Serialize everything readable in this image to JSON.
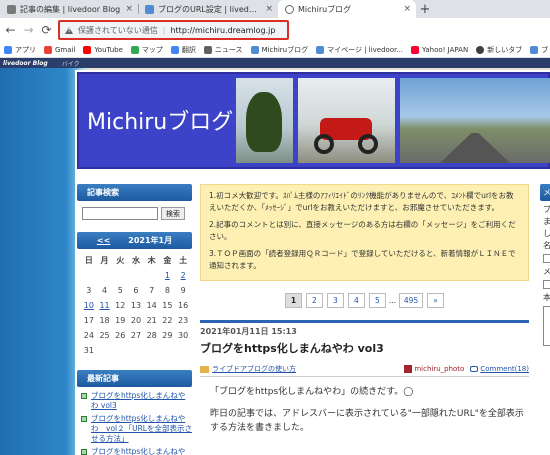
{
  "tabs": [
    {
      "label": "記事の編集 | livedoor Blog",
      "icon": "document-icon"
    },
    {
      "label": "ブログのURL設定 | livedoor Blog",
      "icon": "blog-icon"
    },
    {
      "label": "Michiruブログ",
      "icon": "globe-icon",
      "active": true
    }
  ],
  "new_tab": "+",
  "close_glyph": "×",
  "address": {
    "warning": "保護されていない通信",
    "separator": "|",
    "url": "http://michiru.dreamlog.jp"
  },
  "bookmarks": [
    {
      "label": "アプリ",
      "color": "#4285f4"
    },
    {
      "label": "Gmail",
      "color": "#ea4335"
    },
    {
      "label": "YouTube",
      "color": "#ff0000"
    },
    {
      "label": "マップ",
      "color": "#34a853"
    },
    {
      "label": "翻訳",
      "color": "#4285f4"
    },
    {
      "label": "ニュース",
      "color": "#5f6368"
    },
    {
      "label": "Michiruブログ",
      "color": "#4f8bd6"
    },
    {
      "label": "マイページ | livedoor...",
      "color": "#4f8bd6"
    },
    {
      "label": "Yahoo! JAPAN",
      "color": "#ff0033"
    },
    {
      "label": "新しいタブ",
      "color": "#3c4043"
    },
    {
      "label": "ブ",
      "color": "#4f8bd6"
    }
  ],
  "livedoor_bar": {
    "logo": "livedoor Blog",
    "link": "バイク"
  },
  "blog": {
    "title": "Michiruブログ"
  },
  "sidebar": {
    "search_title": "記事検索",
    "search_button": "検索",
    "calendar": {
      "prev": "<<",
      "month": "2021年1月",
      "weekdays": [
        "日",
        "月",
        "火",
        "水",
        "木",
        "金",
        "土"
      ],
      "weeks": [
        [
          "",
          "",
          "",
          "",
          "",
          "1",
          "2"
        ],
        [
          "3",
          "4",
          "5",
          "6",
          "7",
          "8",
          "9"
        ],
        [
          "10",
          "11",
          "12",
          "13",
          "14",
          "15",
          "16"
        ],
        [
          "17",
          "18",
          "19",
          "20",
          "21",
          "22",
          "23"
        ],
        [
          "24",
          "25",
          "26",
          "27",
          "28",
          "29",
          "30"
        ],
        [
          "31",
          "",
          "",
          "",
          "",
          "",
          ""
        ]
      ]
    },
    "recent_title": "最新記事",
    "recent": [
      "ブログをhttps化しまんねやわ vol3",
      "ブログをhttps化しまんねやわ　vol２「URLを全部表示させる方法」",
      "ブログをhttps化しまんねや"
    ]
  },
  "notice": {
    "p1": "1.初コメ大歓迎です。ｽﾊﾟﾑ主様のｱﾌｨﾘｴｲﾄﾞのﾘﾝｸ機能がありませんので、ｺﾒﾝﾄ欄でurlをお教えいただくか、「ﾒｯｾｰｼﾞ」でurlをお教えいただけますと、お邪魔させていただきます。",
    "p2": "2.記事のコメントとは別に、直接メッセージのある方は右欄の「メッセージ」をご利用ください。",
    "p3": "3.ＴＯＰ画面の「読者登録用ＱＲコード」で登録していただけると、新着情報がＬＩＮＥで通知されます。"
  },
  "pager": {
    "pages": [
      "1",
      "2",
      "3",
      "4",
      "5"
    ],
    "dots": "...",
    "last": "495",
    "next": "»"
  },
  "post": {
    "date": "2021年01月11日 15:13",
    "title": "ブログをhttps化しまんねやわ vol3",
    "category": "ライブドアブログの使い方",
    "author": "michiru_photo",
    "comments": "Comment(18)",
    "body1": "「ブログをhttps化しまんねやわ」の続きだす。◯",
    "body2": "昨日の記事では、アドレスバーに表示されている\"一部隠れたURL\"を全部表示する方法を書きました。"
  },
  "right": {
    "title": "メ",
    "lines": [
      "プ",
      "ま",
      "し",
      "名"
    ],
    "lines2": [
      "メ"
    ],
    "lines3": [
      "本"
    ]
  }
}
